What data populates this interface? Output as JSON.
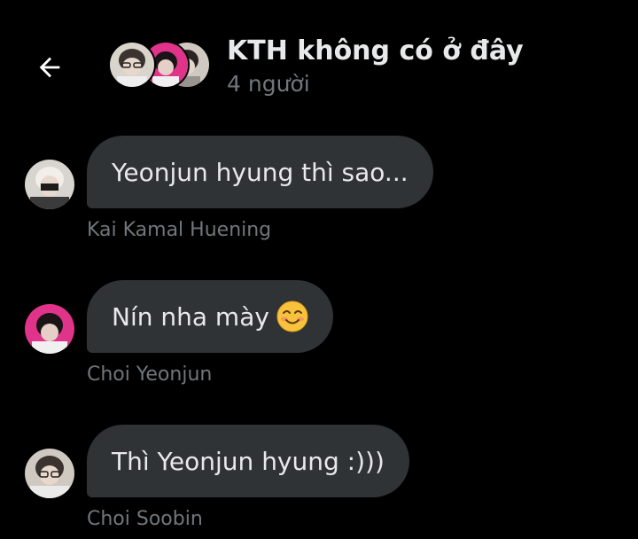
{
  "header": {
    "title": "KTH không có ở đây",
    "subtitle": "4 người",
    "back_icon": "arrow-left-icon",
    "group_avatar_count": 3
  },
  "messages": [
    {
      "text": "Yeonjun hyung thì sao...",
      "sender": "Kai Kamal Huening",
      "avatar_tone": "#d8d4cf"
    },
    {
      "text": "Nín nha mày",
      "emoji": "smiling-face-emoji",
      "sender": "Choi Yeonjun",
      "avatar_tone": "#e0338a"
    },
    {
      "text": "Thì Yeonjun hyung :)))",
      "sender": "Choi Soobin",
      "avatar_tone": "#cfc9c2"
    }
  ],
  "colors": {
    "background": "#000000",
    "bubble": "#2f3336",
    "text_primary": "#e7e9ea",
    "text_secondary": "#71767b"
  }
}
